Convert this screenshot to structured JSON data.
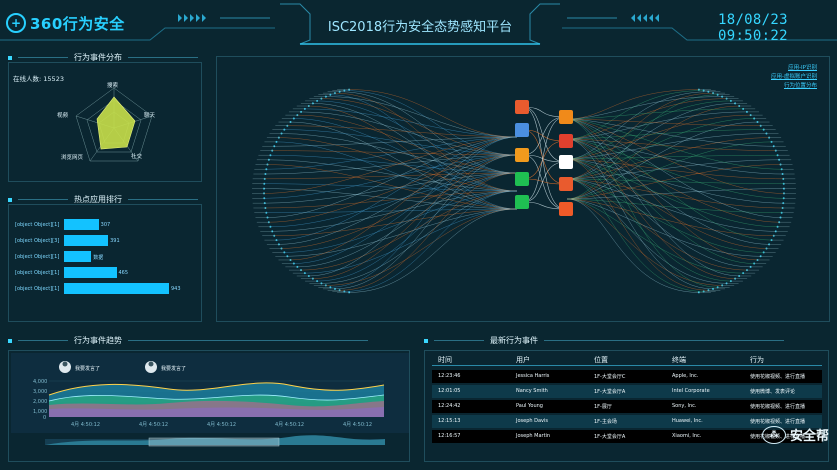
{
  "header": {
    "logo": "360行为安全",
    "title": "ISC2018行为安全态势感知平台",
    "clock": "18/08/23 09:50:22"
  },
  "radar_panel": {
    "title": "行为事件分布",
    "online_label": "在线人数:",
    "online_count": "15523",
    "axes": [
      "搜索",
      "聊天",
      "社交",
      "浏览网页",
      "视频"
    ]
  },
  "bar_panel": {
    "title": "热点应用排行",
    "rows": [
      {
        "label": "[object Object][1]",
        "value": "307",
        "width": 0.33
      },
      {
        "label": "[object Object][3]",
        "value": "391",
        "width": 0.42
      },
      {
        "label": "[object Object][1]",
        "value": "数据",
        "width": 0.26
      },
      {
        "label": "[object Object][1]",
        "value": "465",
        "width": 0.5
      },
      {
        "label": "[object Object][1]",
        "value": "943",
        "width": 1.0
      }
    ]
  },
  "network_panel": {
    "legend": [
      "应用-IP识别",
      "应用-虚拟账户识别",
      "行为位置分布"
    ]
  },
  "trend_panel": {
    "title": "行为事件趋势",
    "tooltips": [
      "我要发言了",
      "我要发言了"
    ],
    "y_ticks": [
      "4,000",
      "3,000",
      "2,000",
      "1,000",
      "0"
    ],
    "x_ticks": [
      "4月 4:50:12",
      "4月 4:50:12",
      "4月 4:50:12",
      "4月 4:50:12",
      "4月 4:50:12"
    ]
  },
  "events_panel": {
    "title": "最新行为事件",
    "columns": [
      "时间",
      "用户",
      "位置",
      "终端",
      "行为"
    ],
    "rows": [
      [
        "12:23:46",
        "Jessica Harris",
        "1F-大堂会厅C",
        "Apple, Inc.",
        "使用花椒视频、进行直播"
      ],
      [
        "12:01:05",
        "Nancy Smith",
        "1F-大堂会厅A",
        "Intel Corporate",
        "使用微博、发表评论"
      ],
      [
        "12:24:42",
        "Paul Young",
        "1F-展厅",
        "Sony, Inc.",
        "使用花椒视频、进行直播"
      ],
      [
        "12:15:13",
        "Joseph Davis",
        "1F-主会场",
        "Huawei, Inc.",
        "使用花椒视频、进行直播"
      ],
      [
        "12:16:57",
        "Joseph Martin",
        "1F-大堂会厅A",
        "Xiaomi, Inc.",
        "使用花椒视频、进行直播"
      ]
    ]
  },
  "watermark": "安全帮",
  "colors": {
    "bg": "#0a2630",
    "accent": "#28d0ff",
    "bar": "#13c2ff",
    "orange": "#e8742a",
    "blue": "#4aa8e0",
    "green": "#3dbb7a"
  }
}
